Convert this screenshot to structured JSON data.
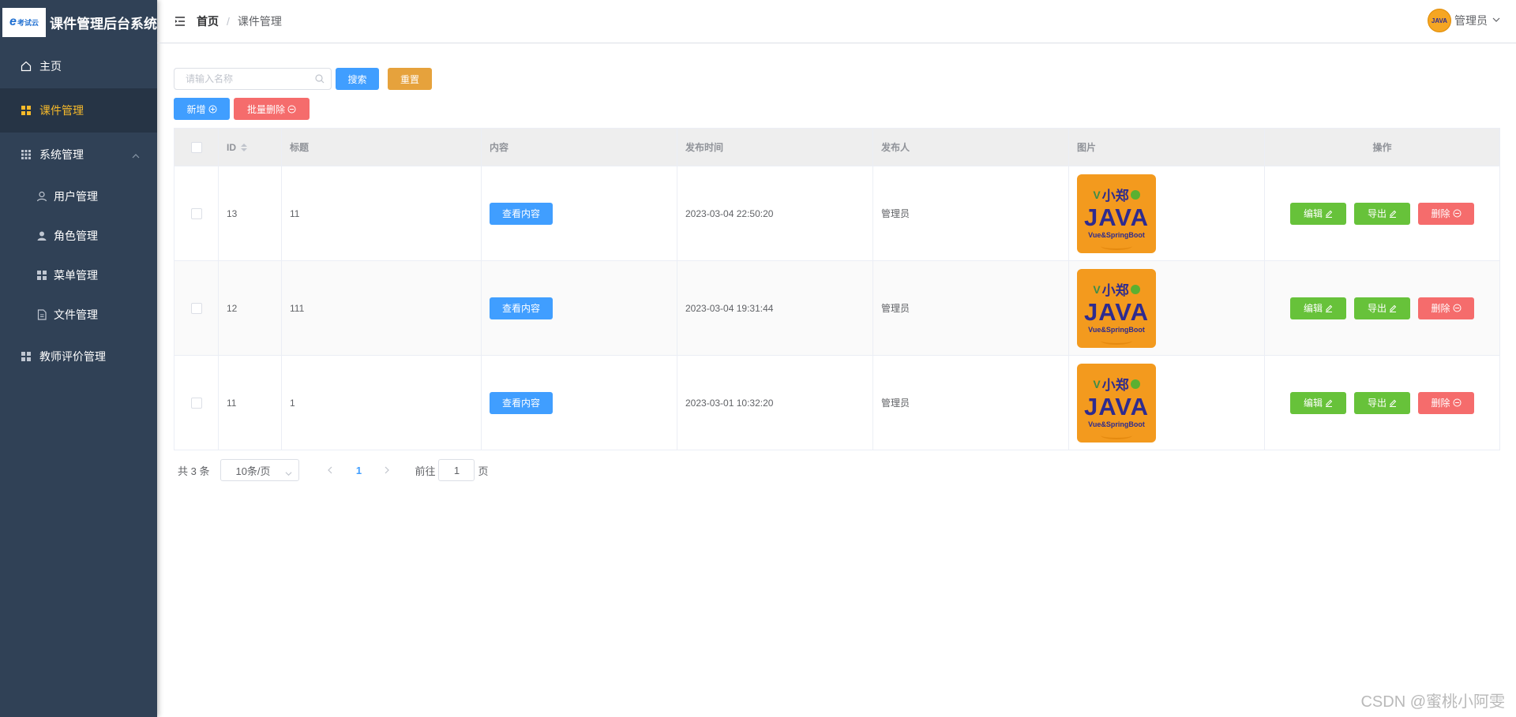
{
  "app": {
    "logo_text": "考试云",
    "logo_glyph": "e",
    "title": "课件管理后台系统"
  },
  "sidebar": {
    "items": [
      {
        "label": "主页",
        "icon": "home-icon",
        "active": false
      },
      {
        "label": "课件管理",
        "icon": "grid-icon",
        "active": true
      },
      {
        "label": "系统管理",
        "icon": "apps-icon",
        "active": false,
        "expanded": true,
        "children": [
          {
            "label": "用户管理",
            "icon": "user-icon"
          },
          {
            "label": "角色管理",
            "icon": "user-solid-icon"
          },
          {
            "label": "菜单管理",
            "icon": "menu-icon"
          },
          {
            "label": "文件管理",
            "icon": "document-icon"
          }
        ]
      },
      {
        "label": "教师评价管理",
        "icon": "grid-icon",
        "active": false
      }
    ],
    "colors": {
      "bg": "#304156",
      "active_text": "#f7ba2a"
    }
  },
  "header": {
    "breadcrumb": [
      "首页",
      "课件管理"
    ],
    "breadcrumb_sep": "/",
    "user": {
      "name": "管理员",
      "avatar_text": "JAVA"
    }
  },
  "toolbar": {
    "search_placeholder": "请输入名称",
    "search_value": "",
    "search_label": "搜索",
    "reset_label": "重置",
    "add_label": "新增",
    "batch_delete_label": "批量删除"
  },
  "table": {
    "columns": [
      "",
      "ID",
      "标题",
      "内容",
      "发布时间",
      "发布人",
      "图片",
      "操作"
    ],
    "rows": [
      {
        "id": "13",
        "title": "11",
        "content_btn": "查看内容",
        "time": "2023-03-04 22:50:20",
        "publisher": "管理员"
      },
      {
        "id": "12",
        "title": "111",
        "content_btn": "查看内容",
        "time": "2023-03-04 19:31:44",
        "publisher": "管理员"
      },
      {
        "id": "11",
        "title": "1",
        "content_btn": "查看内容",
        "time": "2023-03-01 10:32:20",
        "publisher": "管理员"
      }
    ],
    "thumbnail": {
      "line1": "小郑",
      "line2": "JAVA",
      "line3": "Vue&SpringBoot"
    },
    "actions": {
      "edit": "编辑",
      "export": "导出",
      "delete": "删除"
    }
  },
  "pagination": {
    "total_text": "共 3 条",
    "page_size": "10条/页",
    "current_page": "1",
    "goto_label": "前往",
    "goto_value": "1",
    "page_suffix": "页"
  },
  "watermark": "CSDN @蜜桃小阿雯",
  "colors": {
    "primary": "#409eff",
    "warning": "#e6a23c",
    "danger": "#f56c6c",
    "success": "#67c23a"
  }
}
